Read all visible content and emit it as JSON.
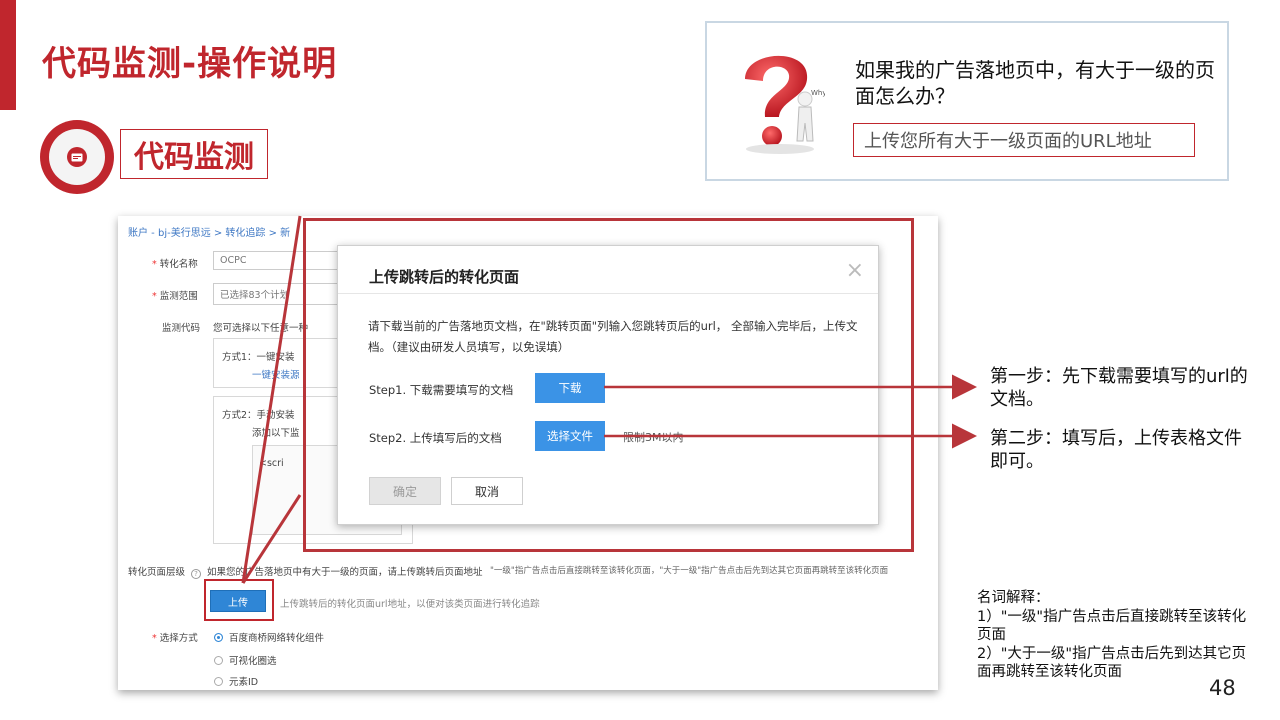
{
  "slide": {
    "title": "代码监测-操作说明",
    "section_label": "代码监测",
    "page_number": "48"
  },
  "faq": {
    "question": "如果我的广告落地页中，有大于一级的页面怎么办？",
    "answer": "上传您所有大于一级页面的URL地址",
    "figure_text": "Why?"
  },
  "screenshot": {
    "breadcrumb": "账户 - bj-美行思远  >  转化追踪  >  新",
    "fields": {
      "conversion_name_label": "转化名称",
      "conversion_name_value": "OCPC",
      "monitor_range_label": "监测范围",
      "monitor_range_value": "已选择83个计划",
      "monitor_code_label": "监测代码",
      "monitor_code_hint": "您可选择以下任意一种",
      "method1": "方式1：一键安装",
      "method1_link": "一键安装源",
      "method2": "方式2：手动安装",
      "method2_hint": "添加以下监",
      "code_snippet": "<scri",
      "page_level_label": "转化页面层级",
      "page_level_help": "?",
      "page_level_text": "如果您的广告落地页中有大于一级的页面，请上传跳转后页面地址",
      "page_level_note": "\"一级\"指广告点击后直接跳转至该转化页面，\"大于一级\"指广告点击后先到达其它页面再跳转至该转化页面",
      "upload_button": "上传",
      "upload_hint": "上传跳转后的转化页面url地址，以便对该类页面进行转化追踪",
      "select_mode_label": "选择方式",
      "options": [
        "百度商桥网络转化组件",
        "可视化圈选",
        "元素ID"
      ]
    },
    "dialog": {
      "title": "上传跳转后的转化页面",
      "close": "×",
      "description": "请下载当前的广告落地页文档，在\"跳转页面\"列输入您跳转页后的url， 全部输入完毕后，上传文档。（建议由研发人员填写，以免误填）",
      "step1_label": "Step1. 下载需要填写的文档",
      "step1_button": "下载",
      "step2_label": "Step2. 上传填写后的文档",
      "step2_button": "选择文件",
      "limit_text": "限制3M以内",
      "ok_button": "确定",
      "cancel_button": "取消"
    }
  },
  "annotations": {
    "step1": "第一步：先下载需要填写的url的文档。",
    "step2": "第二步：填写后，上传表格文件即可。"
  },
  "glossary": {
    "title": "名词解释：",
    "item1": "1）\"一级\"指广告点击后直接跳转至该转化页面",
    "item2": "2）\"大于一级\"指广告点击后先到达其它页面再跳转至该转化页面"
  },
  "colors": {
    "brand_red": "#c0262d",
    "button_blue": "#3b93e6",
    "link_blue": "#3f78c4"
  }
}
